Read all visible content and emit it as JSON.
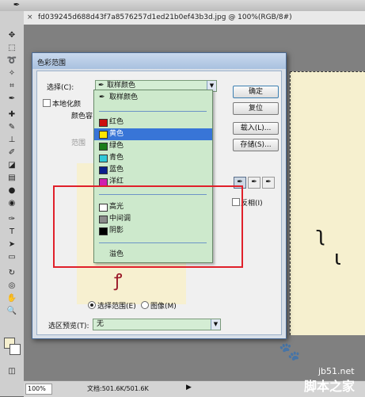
{
  "document": {
    "title": "fd039245d688d43f7a8576257d1ed21b0ef43b3d.jpg @ 100%(RGB/8#)",
    "zoom": "100%",
    "doc_info": "文档:501.6K/501.6K",
    "canvas_color": "#f6f0cf"
  },
  "dialog": {
    "title": "色彩范围",
    "select_label": "选择(C):",
    "select_value": "取样颜色",
    "localized_label": "本地化颜",
    "fuzziness_label": "颜色容",
    "range_label": "范围",
    "buttons": [
      "确定",
      "复位",
      "载入(L)...",
      "存储(S)..."
    ],
    "invert_label": "反相(I)",
    "radio_selection": "选择范围(E)",
    "radio_image": "图像(M)",
    "preview_label": "选区预览(T):",
    "preview_value": "无"
  },
  "dropdown": {
    "items": [
      {
        "label": "取样颜色",
        "icon": "eyedropper-icon"
      },
      {
        "label": "红色",
        "color": "#cc1010"
      },
      {
        "label": "黄色",
        "color": "#ffe600",
        "highlighted": true
      },
      {
        "label": "绿色",
        "color": "#1a7d1a"
      },
      {
        "label": "青色",
        "color": "#30c8d8"
      },
      {
        "label": "蓝色",
        "color": "#0a1e8c"
      },
      {
        "label": "洋红",
        "color": "#d020b0"
      },
      {
        "label": "高光",
        "color": "#ffffff"
      },
      {
        "label": "中间调",
        "color": "#8a8a8a"
      },
      {
        "label": "阴影",
        "color": "#000000"
      },
      {
        "label": "溢色"
      }
    ]
  },
  "watermark": {
    "site": "jb51.net",
    "brand": "脚本之家"
  }
}
